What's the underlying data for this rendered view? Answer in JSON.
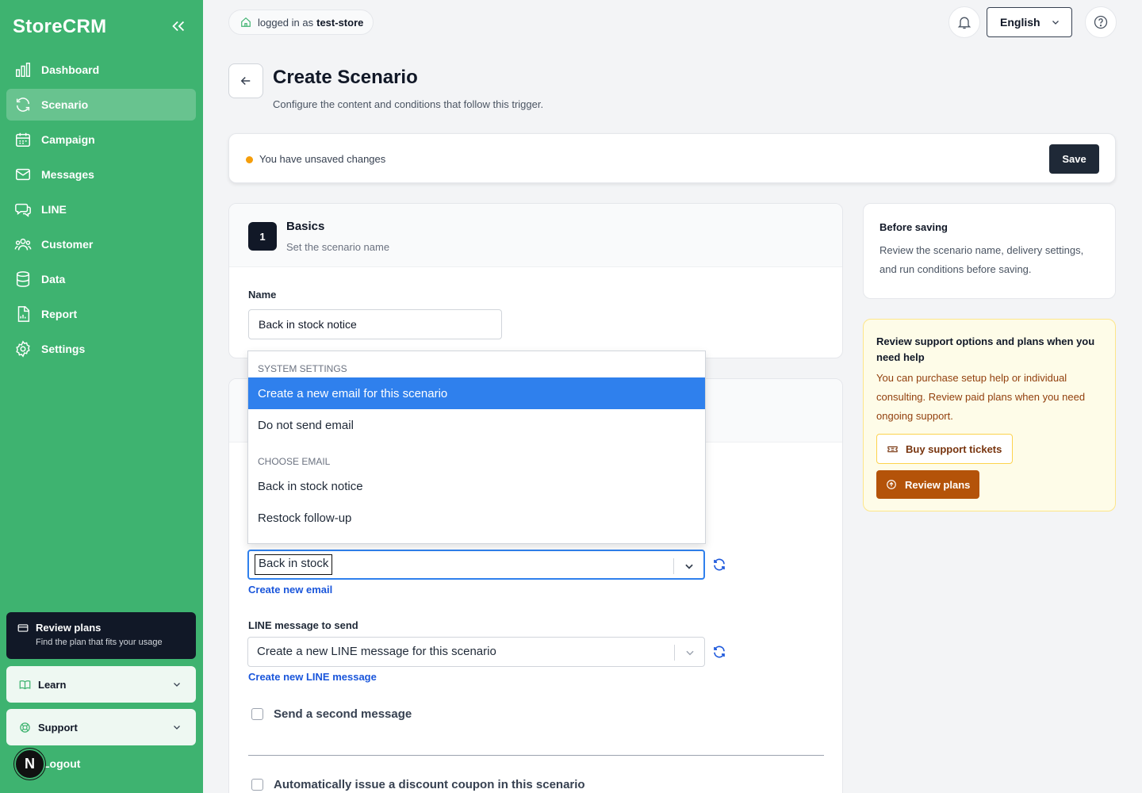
{
  "app": {
    "brand": "StoreCRM"
  },
  "sidebar": {
    "items": [
      {
        "label": "Dashboard",
        "icon": "bar-chart-icon",
        "active": false
      },
      {
        "label": "Scenario",
        "icon": "refresh-icon",
        "active": true
      },
      {
        "label": "Campaign",
        "icon": "calendar-icon",
        "active": false
      },
      {
        "label": "Messages",
        "icon": "mail-icon",
        "active": false
      },
      {
        "label": "LINE",
        "icon": "chat-icon",
        "active": false
      },
      {
        "label": "Customer",
        "icon": "users-icon",
        "active": false
      },
      {
        "label": "Data",
        "icon": "database-icon",
        "active": false
      },
      {
        "label": "Report",
        "icon": "file-chart-icon",
        "active": false
      },
      {
        "label": "Settings",
        "icon": "gear-icon",
        "active": false
      }
    ],
    "promo": {
      "title": "Review plans",
      "subtitle": "Find the plan that fits your usage"
    },
    "learn": "Learn",
    "support": "Support",
    "logout": "Logout",
    "avatar_initial": "N"
  },
  "topbar": {
    "logged_in_prefix": "logged in as",
    "store_name": "test-store",
    "language": "English"
  },
  "header": {
    "title": "Create Scenario",
    "description": "Configure the content and conditions that follow this trigger."
  },
  "unsaved": {
    "text": "You have unsaved changes",
    "save_label": "Save"
  },
  "basics": {
    "step": "1",
    "title": "Basics",
    "subtitle": "Set the scenario name",
    "name_label": "Name",
    "name_value": "Back in stock notice"
  },
  "email": {
    "select_value": "Back in stock",
    "create_link": "Create new email",
    "menu": {
      "groups": [
        {
          "label": "SYSTEM SETTINGS",
          "options": [
            "Create a new email for this scenario",
            "Do not send email"
          ]
        },
        {
          "label": "CHOOSE EMAIL",
          "options": [
            "Back in stock notice",
            "Restock follow-up"
          ]
        }
      ],
      "highlighted": "Create a new email for this scenario"
    }
  },
  "line": {
    "label": "LINE message to send",
    "select_value": "Create a new LINE message for this scenario",
    "create_link": "Create new LINE message"
  },
  "options": {
    "second_message": "Send a second message",
    "coupon": "Automatically issue a discount coupon in this scenario"
  },
  "side": {
    "before_saving_title": "Before saving",
    "before_saving_text": "Review the scenario name, delivery settings, and run conditions before saving.",
    "help_title": "Review support options and plans when you need help",
    "help_text": "You can purchase setup help or individual consulting. Review paid plans when you need ongoing support.",
    "tickets_label": "Buy support tickets",
    "plans_label": "Review plans"
  },
  "colors": {
    "sidebar": "#3eb370",
    "accent": "#2f80ed",
    "dark": "#111827",
    "warning": "#f59e0b",
    "plans": "#b45309"
  }
}
